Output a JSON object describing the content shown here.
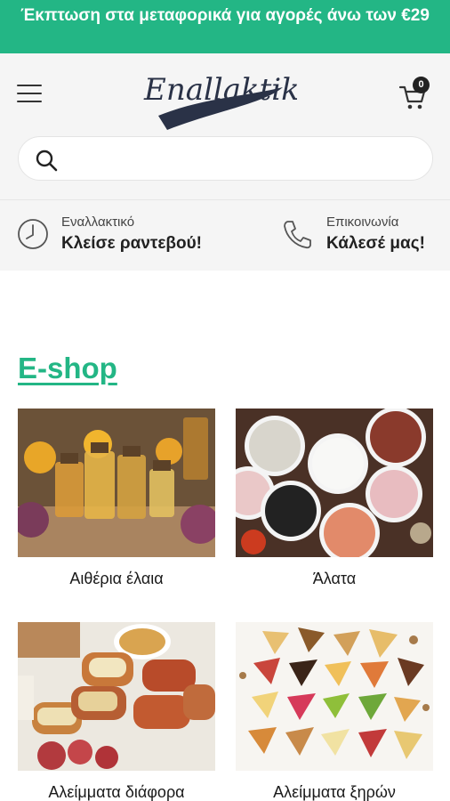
{
  "promo": {
    "text": "Έκπτωση στα μεταφορικά για αγορές άνω των €29"
  },
  "header": {
    "logo_text": "Enallaktiko",
    "cart_count": "0"
  },
  "search": {
    "placeholder": "",
    "value": ""
  },
  "info": {
    "appointment": {
      "small": "Εναλλακτικό",
      "big": "Κλείσε ραντεβού!",
      "icon": "clock-icon"
    },
    "contact": {
      "small": "Επικοινωνία",
      "big": "Κάλεσέ μας!",
      "icon": "phone-icon"
    }
  },
  "eshop": {
    "title": "E-shop",
    "categories": [
      {
        "label": "Αιθέρια έλαια"
      },
      {
        "label": "Άλατα"
      },
      {
        "label": "Αλείμματα διάφορα"
      },
      {
        "label": "Αλείμματα ξηρών"
      }
    ]
  },
  "colors": {
    "brand": "#23b685",
    "header_bg": "#f5f5f5"
  }
}
